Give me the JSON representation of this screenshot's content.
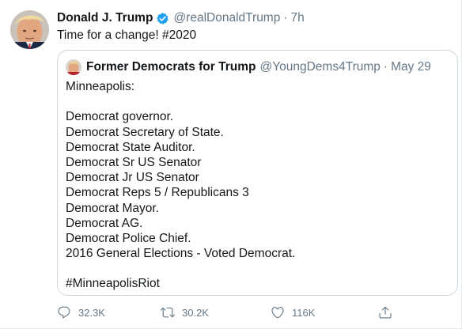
{
  "tweet": {
    "display_name": "Donald J. Trump",
    "handle": "@realDonaldTrump",
    "separator": "·",
    "time": "7h",
    "text": "Time for a change! #2020",
    "verified": true
  },
  "quoted_tweet": {
    "display_name": "Former Democrats for Trump",
    "handle": "@YoungDems4Trump",
    "separator": "·",
    "date": "May 29",
    "lines": [
      "Minneapolis:",
      "",
      "Democrat governor.",
      "Democrat Secretary of State.",
      "Democrat State Auditor.",
      "Democrat Sr US Senator",
      "Democrat Jr US Senator",
      "Democrat Reps 5 / Republicans 3",
      "Democrat Mayor.",
      "Democrat AG.",
      "Democrat Police Chief.",
      "2016 General Elections - Voted Democrat.",
      "",
      "#MinneapolisRiot"
    ]
  },
  "actions": {
    "reply_count": "32.3K",
    "retweet_count": "30.2K",
    "like_count": "116K",
    "reply_icon": "reply-icon",
    "retweet_icon": "retweet-icon",
    "like_icon": "heart-icon",
    "share_icon": "share-icon"
  },
  "colors": {
    "text_primary": "#14171a",
    "text_secondary": "#657786",
    "verified_blue": "#1da1f2",
    "border": "#ccd6dd"
  }
}
